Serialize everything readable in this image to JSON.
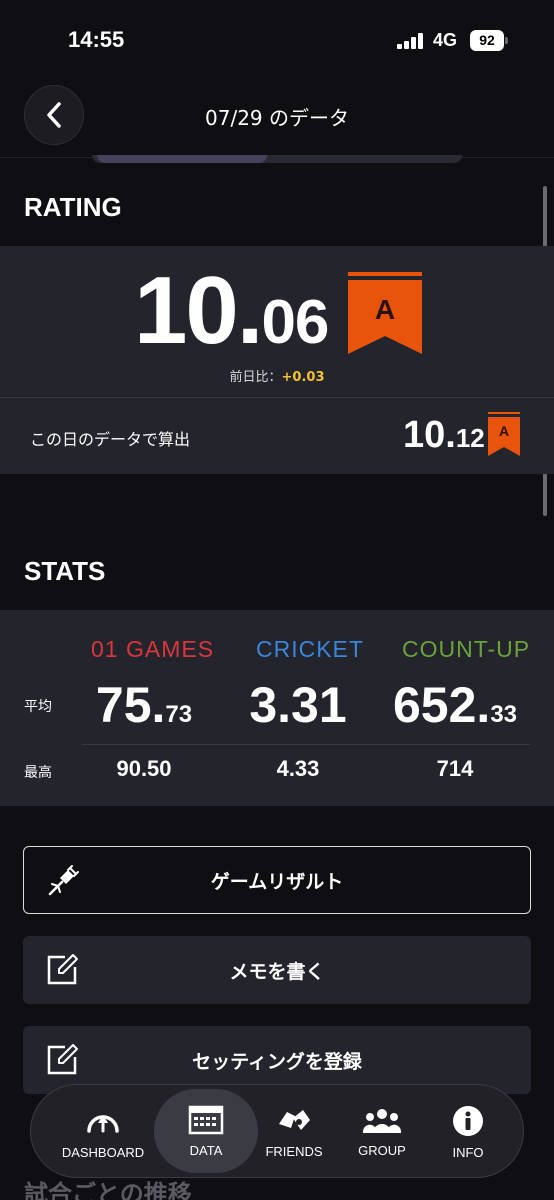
{
  "status_bar": {
    "time": "14:55",
    "network": "4G",
    "battery": "92"
  },
  "header": {
    "title": "07/29 のデータ"
  },
  "rating": {
    "section_title": "RATING",
    "value_int": "10.",
    "value_dec": "06",
    "grade": "A",
    "diff_label": "前日比：",
    "diff_value": "+0.03",
    "calc_label": "この日のデータで算出",
    "calc_int": "10.",
    "calc_dec": "12",
    "calc_grade": "A",
    "grade_color": "#e8540c"
  },
  "stats": {
    "section_title": "STATS",
    "columns": [
      {
        "name": "01 GAMES",
        "color": "#d9363e",
        "avg_int": "75.",
        "avg_dec": "73",
        "max": "90.50"
      },
      {
        "name": "CRICKET",
        "color": "#3a86d8",
        "avg_int": "3.31",
        "avg_dec": "",
        "max": "4.33"
      },
      {
        "name": "COUNT-UP",
        "color": "#6aa33a",
        "avg_int": "652.",
        "avg_dec": "33",
        "max": "714"
      }
    ],
    "row_avg": "平均",
    "row_max": "最高"
  },
  "buttons": {
    "game_result": "ゲームリザルト",
    "memo": "メモを書く",
    "setting": "セッティングを登録"
  },
  "next_section": "試合ごとの推移",
  "tabbar": {
    "items": [
      {
        "label": "DASHBOARD",
        "icon": "dashboard-icon"
      },
      {
        "label": "DATA",
        "icon": "data-icon"
      },
      {
        "label": "FRIENDS",
        "icon": "friends-icon"
      },
      {
        "label": "GROUP",
        "icon": "group-icon"
      },
      {
        "label": "INFO",
        "icon": "info-icon"
      }
    ],
    "active": "DATA"
  }
}
